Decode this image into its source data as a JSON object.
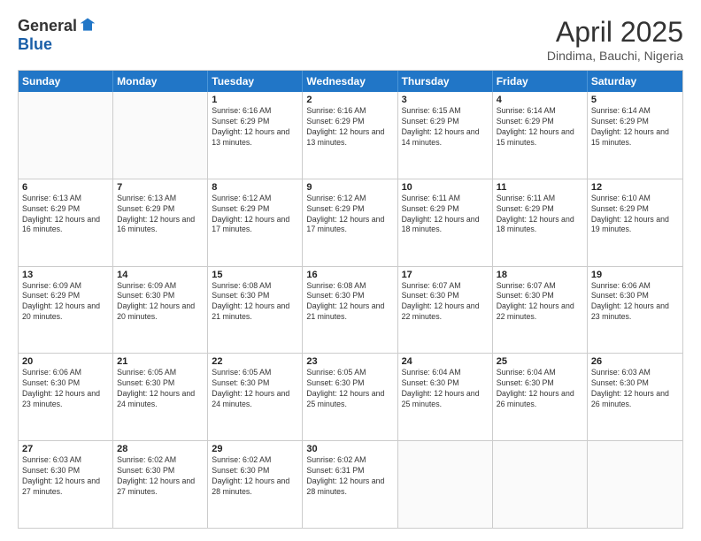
{
  "logo": {
    "general": "General",
    "blue": "Blue"
  },
  "title": "April 2025",
  "location": "Dindima, Bauchi, Nigeria",
  "days": [
    "Sunday",
    "Monday",
    "Tuesday",
    "Wednesday",
    "Thursday",
    "Friday",
    "Saturday"
  ],
  "rows": [
    [
      {
        "day": "",
        "info": ""
      },
      {
        "day": "",
        "info": ""
      },
      {
        "day": "1",
        "info": "Sunrise: 6:16 AM\nSunset: 6:29 PM\nDaylight: 12 hours and 13 minutes."
      },
      {
        "day": "2",
        "info": "Sunrise: 6:16 AM\nSunset: 6:29 PM\nDaylight: 12 hours and 13 minutes."
      },
      {
        "day": "3",
        "info": "Sunrise: 6:15 AM\nSunset: 6:29 PM\nDaylight: 12 hours and 14 minutes."
      },
      {
        "day": "4",
        "info": "Sunrise: 6:14 AM\nSunset: 6:29 PM\nDaylight: 12 hours and 15 minutes."
      },
      {
        "day": "5",
        "info": "Sunrise: 6:14 AM\nSunset: 6:29 PM\nDaylight: 12 hours and 15 minutes."
      }
    ],
    [
      {
        "day": "6",
        "info": "Sunrise: 6:13 AM\nSunset: 6:29 PM\nDaylight: 12 hours and 16 minutes."
      },
      {
        "day": "7",
        "info": "Sunrise: 6:13 AM\nSunset: 6:29 PM\nDaylight: 12 hours and 16 minutes."
      },
      {
        "day": "8",
        "info": "Sunrise: 6:12 AM\nSunset: 6:29 PM\nDaylight: 12 hours and 17 minutes."
      },
      {
        "day": "9",
        "info": "Sunrise: 6:12 AM\nSunset: 6:29 PM\nDaylight: 12 hours and 17 minutes."
      },
      {
        "day": "10",
        "info": "Sunrise: 6:11 AM\nSunset: 6:29 PM\nDaylight: 12 hours and 18 minutes."
      },
      {
        "day": "11",
        "info": "Sunrise: 6:11 AM\nSunset: 6:29 PM\nDaylight: 12 hours and 18 minutes."
      },
      {
        "day": "12",
        "info": "Sunrise: 6:10 AM\nSunset: 6:29 PM\nDaylight: 12 hours and 19 minutes."
      }
    ],
    [
      {
        "day": "13",
        "info": "Sunrise: 6:09 AM\nSunset: 6:29 PM\nDaylight: 12 hours and 20 minutes."
      },
      {
        "day": "14",
        "info": "Sunrise: 6:09 AM\nSunset: 6:30 PM\nDaylight: 12 hours and 20 minutes."
      },
      {
        "day": "15",
        "info": "Sunrise: 6:08 AM\nSunset: 6:30 PM\nDaylight: 12 hours and 21 minutes."
      },
      {
        "day": "16",
        "info": "Sunrise: 6:08 AM\nSunset: 6:30 PM\nDaylight: 12 hours and 21 minutes."
      },
      {
        "day": "17",
        "info": "Sunrise: 6:07 AM\nSunset: 6:30 PM\nDaylight: 12 hours and 22 minutes."
      },
      {
        "day": "18",
        "info": "Sunrise: 6:07 AM\nSunset: 6:30 PM\nDaylight: 12 hours and 22 minutes."
      },
      {
        "day": "19",
        "info": "Sunrise: 6:06 AM\nSunset: 6:30 PM\nDaylight: 12 hours and 23 minutes."
      }
    ],
    [
      {
        "day": "20",
        "info": "Sunrise: 6:06 AM\nSunset: 6:30 PM\nDaylight: 12 hours and 23 minutes."
      },
      {
        "day": "21",
        "info": "Sunrise: 6:05 AM\nSunset: 6:30 PM\nDaylight: 12 hours and 24 minutes."
      },
      {
        "day": "22",
        "info": "Sunrise: 6:05 AM\nSunset: 6:30 PM\nDaylight: 12 hours and 24 minutes."
      },
      {
        "day": "23",
        "info": "Sunrise: 6:05 AM\nSunset: 6:30 PM\nDaylight: 12 hours and 25 minutes."
      },
      {
        "day": "24",
        "info": "Sunrise: 6:04 AM\nSunset: 6:30 PM\nDaylight: 12 hours and 25 minutes."
      },
      {
        "day": "25",
        "info": "Sunrise: 6:04 AM\nSunset: 6:30 PM\nDaylight: 12 hours and 26 minutes."
      },
      {
        "day": "26",
        "info": "Sunrise: 6:03 AM\nSunset: 6:30 PM\nDaylight: 12 hours and 26 minutes."
      }
    ],
    [
      {
        "day": "27",
        "info": "Sunrise: 6:03 AM\nSunset: 6:30 PM\nDaylight: 12 hours and 27 minutes."
      },
      {
        "day": "28",
        "info": "Sunrise: 6:02 AM\nSunset: 6:30 PM\nDaylight: 12 hours and 27 minutes."
      },
      {
        "day": "29",
        "info": "Sunrise: 6:02 AM\nSunset: 6:30 PM\nDaylight: 12 hours and 28 minutes."
      },
      {
        "day": "30",
        "info": "Sunrise: 6:02 AM\nSunset: 6:31 PM\nDaylight: 12 hours and 28 minutes."
      },
      {
        "day": "",
        "info": ""
      },
      {
        "day": "",
        "info": ""
      },
      {
        "day": "",
        "info": ""
      }
    ]
  ]
}
